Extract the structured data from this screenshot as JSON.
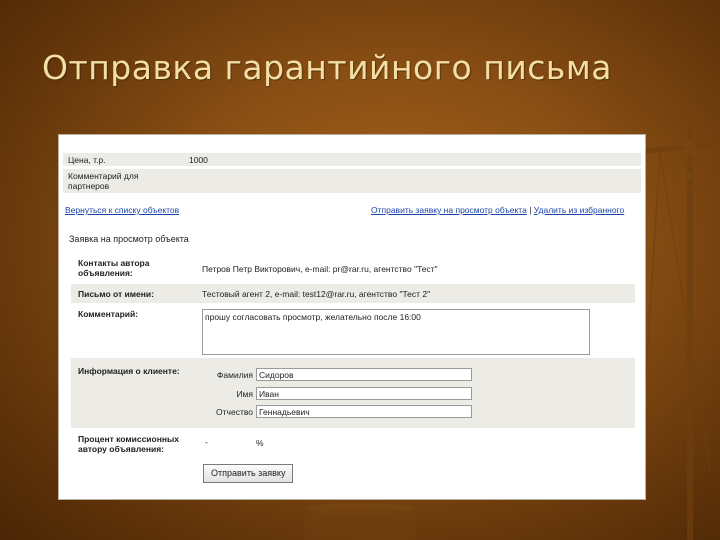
{
  "slide": {
    "title": "Отправка гарантийного письма"
  },
  "info": {
    "price_label": "Цена, т.р.",
    "price_value": "1000",
    "comment_label": "Комментарий для партнеров"
  },
  "links": {
    "back": "Вернуться к списку объектов",
    "send_request": "Отправить заявку на просмотр объекта",
    "separator": "|",
    "remove_favorite": "Удалить из избранного"
  },
  "form": {
    "heading": "Заявка на просмотр объекта",
    "author_contacts_label": "Контакты автора объявления:",
    "author_contacts_value": "Петров Петр Викторович, e-mail: pr@rar.ru, агентство \"Тест\"",
    "from_label": "Письмо от имени:",
    "from_value": "Тестовый агент 2, e-mail: test12@rar.ru, агентство \"Тест 2\"",
    "comment_label": "Комментарий:",
    "comment_value": "прошу согласовать просмотр, желательно после 16:00",
    "client_label": "Информация о клиенте:",
    "surname_label": "Фамилия",
    "surname_value": "Сидоров",
    "name_label": "Имя",
    "name_value": "Иван",
    "patronymic_label": "Отчество",
    "patronymic_value": "Геннадьевич",
    "commission_label": "Процент комиссионных автору объявления:",
    "commission_value": "-",
    "percent_sign": "%",
    "submit_label": "Отправить заявку"
  },
  "colors": {
    "background": "#8a4f14",
    "title": "#f3dfa3",
    "row_gray": "#ecebe6",
    "link": "#1a44a8"
  }
}
